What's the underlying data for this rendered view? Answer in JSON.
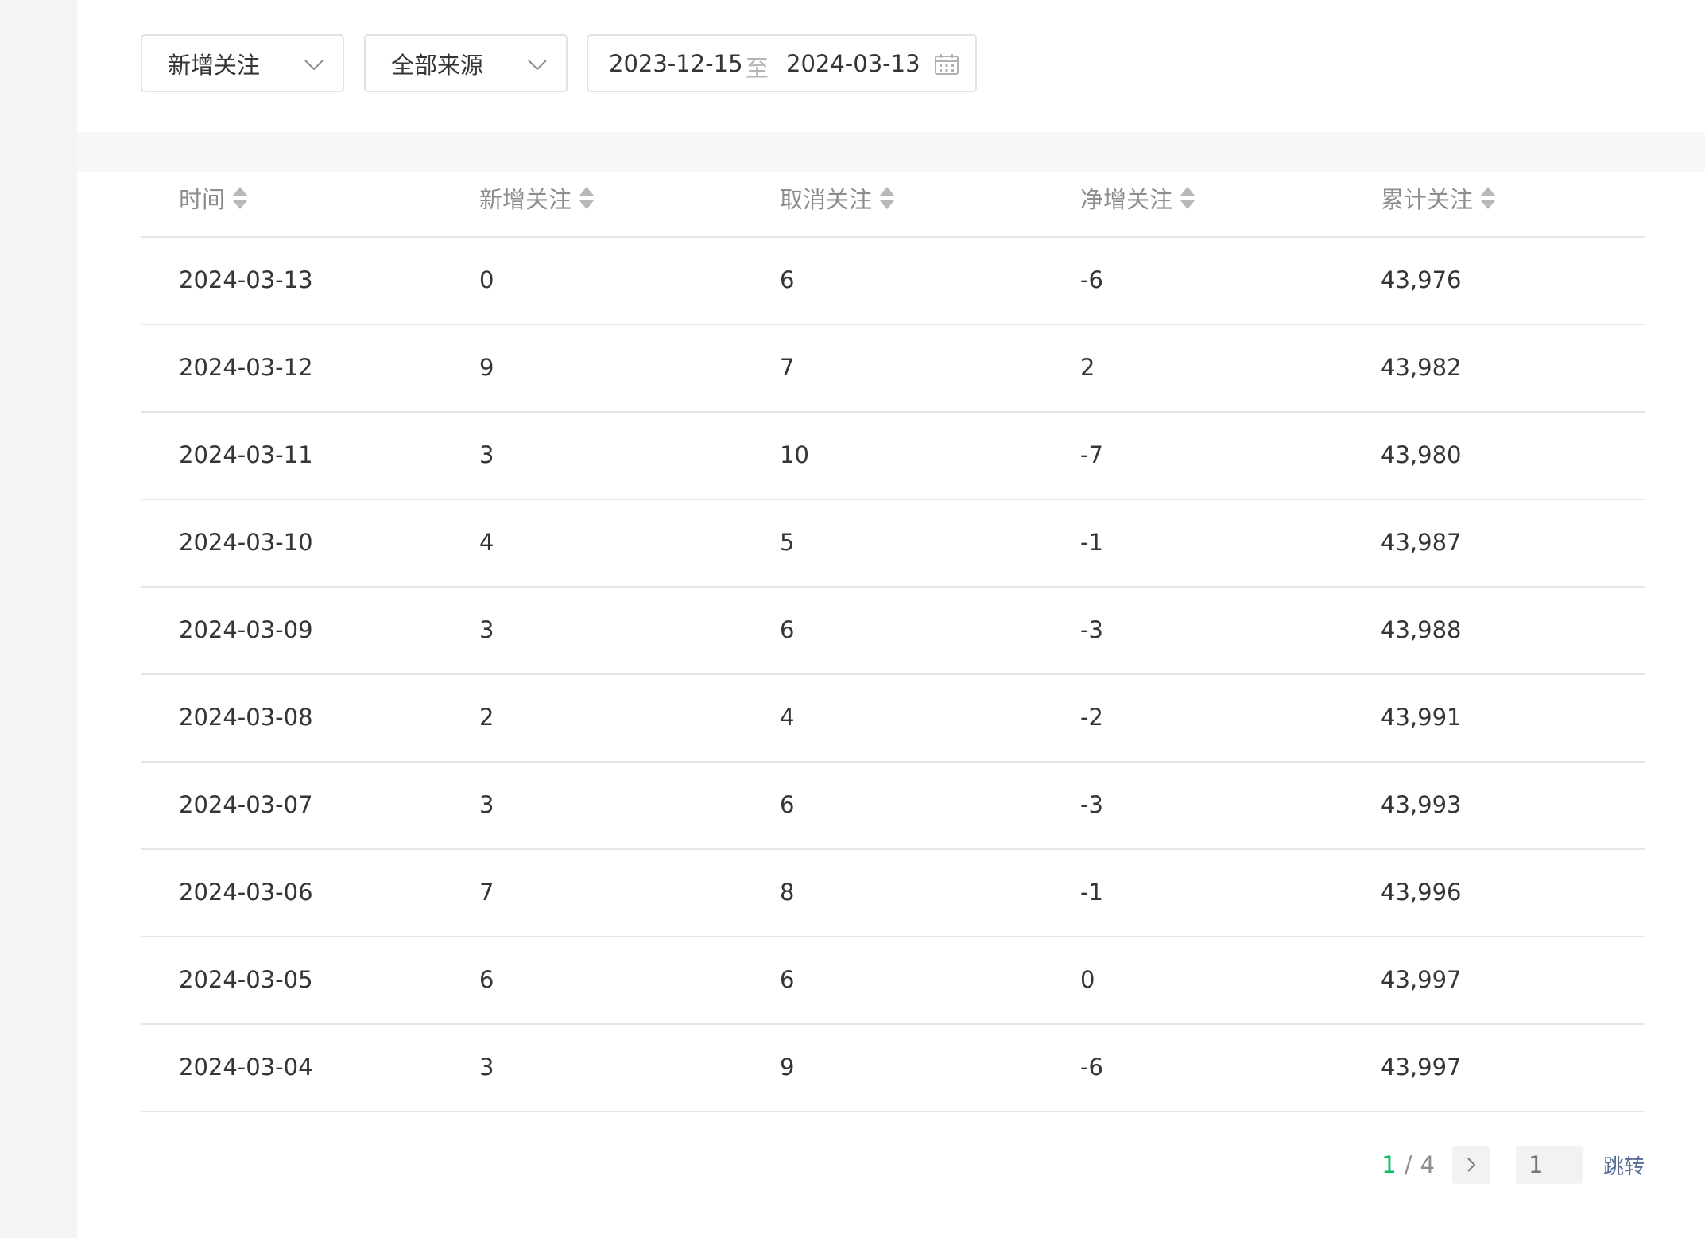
{
  "filters": {
    "metric_select": "新增关注",
    "source_select": "全部来源",
    "date_range": {
      "start": "2023-12-15",
      "separator": "至",
      "end": "2024-03-13"
    }
  },
  "table": {
    "headers": [
      "时间",
      "新增关注",
      "取消关注",
      "净增关注",
      "累计关注"
    ],
    "rows": [
      [
        "2024-03-13",
        "0",
        "6",
        "-6",
        "43,976"
      ],
      [
        "2024-03-12",
        "9",
        "7",
        "2",
        "43,982"
      ],
      [
        "2024-03-11",
        "3",
        "10",
        "-7",
        "43,980"
      ],
      [
        "2024-03-10",
        "4",
        "5",
        "-1",
        "43,987"
      ],
      [
        "2024-03-09",
        "3",
        "6",
        "-3",
        "43,988"
      ],
      [
        "2024-03-08",
        "2",
        "4",
        "-2",
        "43,991"
      ],
      [
        "2024-03-07",
        "3",
        "6",
        "-3",
        "43,993"
      ],
      [
        "2024-03-06",
        "7",
        "8",
        "-1",
        "43,996"
      ],
      [
        "2024-03-05",
        "6",
        "6",
        "0",
        "43,997"
      ],
      [
        "2024-03-04",
        "3",
        "9",
        "-6",
        "43,997"
      ]
    ]
  },
  "pagination": {
    "current": "1",
    "slash": "/",
    "total": "4",
    "input_placeholder": "1",
    "jump_label": "跳转"
  },
  "colors": {
    "accent_green": "#07c160",
    "link_blue": "#576b95",
    "header_text": "#8d8d8d",
    "body_text": "#353535"
  },
  "icons": [
    "chevron-down-icon",
    "calendar-icon",
    "sort-icon",
    "chevron-right-icon"
  ]
}
